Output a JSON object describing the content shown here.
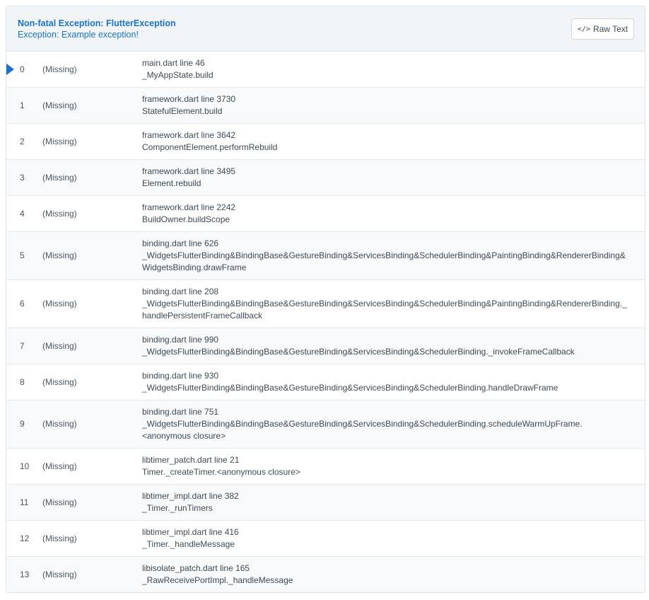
{
  "header": {
    "title": "Non-fatal Exception: FlutterException",
    "subtitle": "Exception: Example exception!",
    "raw_button_label": "Raw Text",
    "raw_button_icon": "</>"
  },
  "colors": {
    "accent": "#1a73c8",
    "header_bg": "#f1f5f8"
  },
  "frames": [
    {
      "index": "0",
      "library": "(Missing)",
      "lines": [
        "main.dart line 46",
        "_MyAppState.build"
      ],
      "active": true
    },
    {
      "index": "1",
      "library": "(Missing)",
      "lines": [
        "framework.dart line 3730",
        "StatefulElement.build"
      ]
    },
    {
      "index": "2",
      "library": "(Missing)",
      "lines": [
        "framework.dart line 3642",
        "ComponentElement.performRebuild"
      ]
    },
    {
      "index": "3",
      "library": "(Missing)",
      "lines": [
        "framework.dart line 3495",
        "Element.rebuild"
      ]
    },
    {
      "index": "4",
      "library": "(Missing)",
      "lines": [
        "framework.dart line 2242",
        "BuildOwner.buildScope"
      ]
    },
    {
      "index": "5",
      "library": "(Missing)",
      "lines": [
        "binding.dart line 626",
        "_WidgetsFlutterBinding&BindingBase&GestureBinding&ServicesBinding&SchedulerBinding&PaintingBinding&RendererBinding&",
        "WidgetsBinding.drawFrame"
      ]
    },
    {
      "index": "6",
      "library": "(Missing)",
      "lines": [
        "binding.dart line 208",
        "_WidgetsFlutterBinding&BindingBase&GestureBinding&ServicesBinding&SchedulerBinding&PaintingBinding&RendererBinding._",
        "handlePersistentFrameCallback"
      ]
    },
    {
      "index": "7",
      "library": "(Missing)",
      "lines": [
        "binding.dart line 990",
        "_WidgetsFlutterBinding&BindingBase&GestureBinding&ServicesBinding&SchedulerBinding._invokeFrameCallback"
      ]
    },
    {
      "index": "8",
      "library": "(Missing)",
      "lines": [
        "binding.dart line 930",
        "_WidgetsFlutterBinding&BindingBase&GestureBinding&ServicesBinding&SchedulerBinding.handleDrawFrame"
      ]
    },
    {
      "index": "9",
      "library": "(Missing)",
      "lines": [
        "binding.dart line 751",
        "_WidgetsFlutterBinding&BindingBase&GestureBinding&ServicesBinding&SchedulerBinding.scheduleWarmUpFrame.",
        "<anonymous closure>"
      ]
    },
    {
      "index": "10",
      "library": "(Missing)",
      "lines": [
        "libtimer_patch.dart line 21",
        "Timer._createTimer.<anonymous closure>"
      ]
    },
    {
      "index": "11",
      "library": "(Missing)",
      "lines": [
        "libtimer_impl.dart line 382",
        "_Timer._runTimers"
      ]
    },
    {
      "index": "12",
      "library": "(Missing)",
      "lines": [
        "libtimer_impl.dart line 416",
        "_Timer._handleMessage"
      ]
    },
    {
      "index": "13",
      "library": "(Missing)",
      "lines": [
        "libisolate_patch.dart line 165",
        "_RawReceivePortImpl._handleMessage"
      ]
    }
  ]
}
